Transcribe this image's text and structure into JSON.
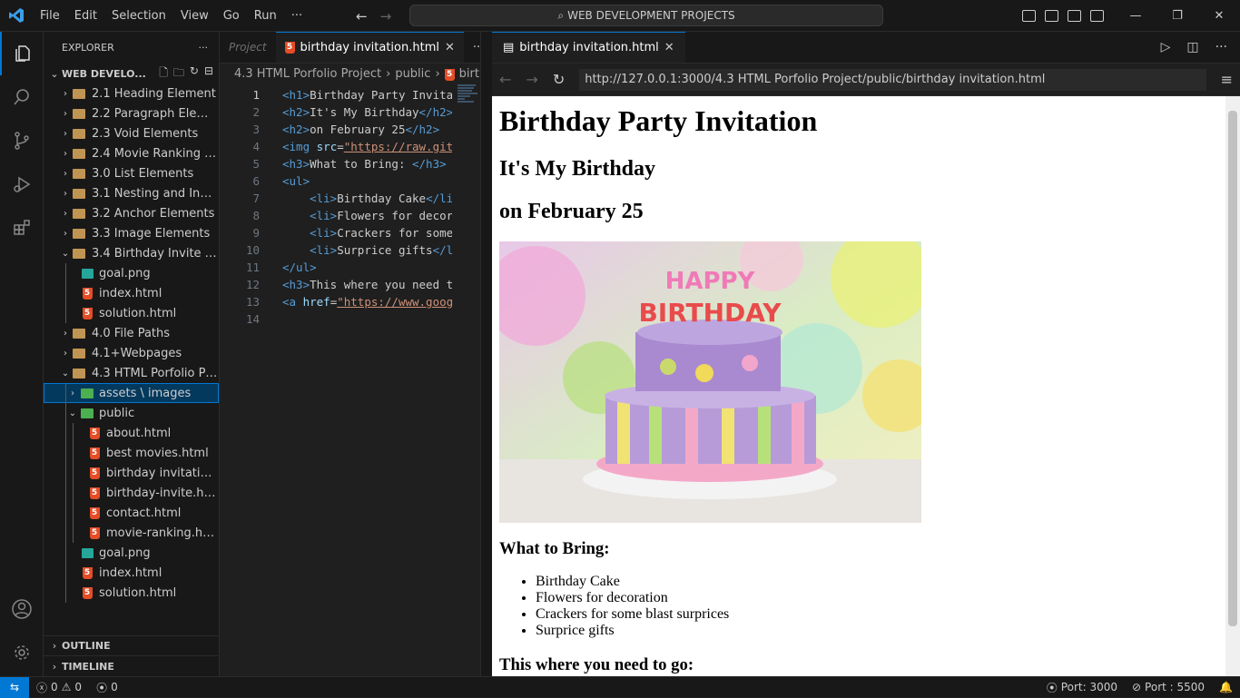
{
  "titlebar": {
    "menu": [
      "File",
      "Edit",
      "Selection",
      "View",
      "Go",
      "Run",
      "···"
    ],
    "command_center": "WEB DEVELOPMENT PROJECTS"
  },
  "explorer": {
    "header": "EXPLORER",
    "more": "···",
    "root": "WEB DEVELO...",
    "tree": [
      {
        "label": "2.1 Heading Element",
        "type": "folder",
        "depth": 1,
        "open": false
      },
      {
        "label": "2.2 Paragraph Element",
        "type": "folder",
        "depth": 1,
        "open": false
      },
      {
        "label": "2.3 Void Elements",
        "type": "folder",
        "depth": 1,
        "open": false
      },
      {
        "label": "2.4 Movie Ranking Pr...",
        "type": "folder",
        "depth": 1,
        "open": false
      },
      {
        "label": "3.0 List Elements",
        "type": "folder",
        "depth": 1,
        "open": false
      },
      {
        "label": "3.1 Nesting and Inden...",
        "type": "folder",
        "depth": 1,
        "open": false
      },
      {
        "label": "3.2 Anchor Elements",
        "type": "folder",
        "depth": 1,
        "open": false
      },
      {
        "label": "3.3 Image Elements",
        "type": "folder",
        "depth": 1,
        "open": false
      },
      {
        "label": "3.4 Birthday Invite Pro...",
        "type": "folder",
        "depth": 1,
        "open": true
      },
      {
        "label": "goal.png",
        "type": "png",
        "depth": 2
      },
      {
        "label": "index.html",
        "type": "html",
        "depth": 2
      },
      {
        "label": "solution.html",
        "type": "html",
        "depth": 2
      },
      {
        "label": "4.0 File Paths",
        "type": "folder",
        "depth": 1,
        "open": false
      },
      {
        "label": "4.1+Webpages",
        "type": "folder",
        "depth": 1,
        "open": false
      },
      {
        "label": "4.3 HTML Porfolio Proj...",
        "type": "folder",
        "depth": 1,
        "open": true
      },
      {
        "label": "assets \\ images",
        "type": "ifolder",
        "depth": 2,
        "open": false,
        "selected": true
      },
      {
        "label": "public",
        "type": "ifolder",
        "depth": 2,
        "open": true
      },
      {
        "label": "about.html",
        "type": "html",
        "depth": 3
      },
      {
        "label": "best movies.html",
        "type": "html",
        "depth": 3
      },
      {
        "label": "birthday invitation....",
        "type": "html",
        "depth": 3
      },
      {
        "label": "birthday-invite.html",
        "type": "html",
        "depth": 3
      },
      {
        "label": "contact.html",
        "type": "html",
        "depth": 3
      },
      {
        "label": "movie-ranking.html",
        "type": "html",
        "depth": 3
      },
      {
        "label": "goal.png",
        "type": "png",
        "depth": 2
      },
      {
        "label": "index.html",
        "type": "html",
        "depth": 2
      },
      {
        "label": "solution.html",
        "type": "html",
        "depth": 2
      }
    ],
    "outline": "OUTLINE",
    "timeline": "TIMELINE"
  },
  "editor": {
    "preview_tab": "Project",
    "tab": "birthday invitation.html",
    "more": "···",
    "breadcrumb": [
      "4.3 HTML Porfolio Project",
      "public",
      "birthday"
    ],
    "lines": [
      [
        [
          "t",
          "<h1>"
        ],
        [
          "x",
          "Birthday Party Invitation"
        ]
      ],
      [
        [
          "t",
          "<h2>"
        ],
        [
          "x",
          "It's My Birthday"
        ],
        [
          "t",
          "</h2>"
        ]
      ],
      [
        [
          "t",
          "<h2>"
        ],
        [
          "x",
          "on February 25"
        ],
        [
          "t",
          "</h2>"
        ]
      ],
      [
        [
          "t",
          "<img "
        ],
        [
          "a",
          "src"
        ],
        [
          "x",
          "="
        ],
        [
          "s",
          "\"https://raw.githubusercontent"
        ]
      ],
      [
        [
          "t",
          "<h3>"
        ],
        [
          "x",
          "What to Bring: "
        ],
        [
          "t",
          "</h3>"
        ]
      ],
      [
        [
          "t",
          "<ul>"
        ]
      ],
      [
        [
          "x",
          "    "
        ],
        [
          "t",
          "<li>"
        ],
        [
          "x",
          "Birthday Cake"
        ],
        [
          "t",
          "</li>"
        ]
      ],
      [
        [
          "x",
          "    "
        ],
        [
          "t",
          "<li>"
        ],
        [
          "x",
          "Flowers for decoration"
        ]
      ],
      [
        [
          "x",
          "    "
        ],
        [
          "t",
          "<li>"
        ],
        [
          "x",
          "Crackers for some blast"
        ]
      ],
      [
        [
          "x",
          "    "
        ],
        [
          "t",
          "<li>"
        ],
        [
          "x",
          "Surprice gifts"
        ],
        [
          "t",
          "</li>"
        ]
      ],
      [
        [
          "t",
          "</ul>"
        ]
      ],
      [
        [
          "t",
          "<h3>"
        ],
        [
          "x",
          "This where you need to go"
        ]
      ],
      [
        [
          "t",
          "<a "
        ],
        [
          "a",
          "href"
        ],
        [
          "x",
          "="
        ],
        [
          "s",
          "\"https://www.google.com/maps"
        ]
      ],
      []
    ]
  },
  "browser": {
    "tab": "birthday invitation.html",
    "url": "http://127.0.0.1:3000/4.3 HTML Porfolio Project/public/birthday invitation.html",
    "page": {
      "h1": "Birthday Party Invitation",
      "h2a": "It's My Birthday",
      "h2b": "on February 25",
      "cake_text": "HAPPY BIRTHDAY",
      "h3a": "What to Bring:",
      "items": [
        "Birthday Cake",
        "Flowers for decoration",
        "Crackers for some blast surprices",
        "Surprice gifts"
      ],
      "h3b": "This where you need to go:"
    }
  },
  "statusbar": {
    "errors": "0",
    "warnings": "0",
    "ports": "0",
    "port1": "Port: 3000",
    "port2": "Port : 5500"
  },
  "colors": {
    "accent": "#0078d4",
    "html_icon": "#e44d26",
    "folder": "#c09553"
  }
}
